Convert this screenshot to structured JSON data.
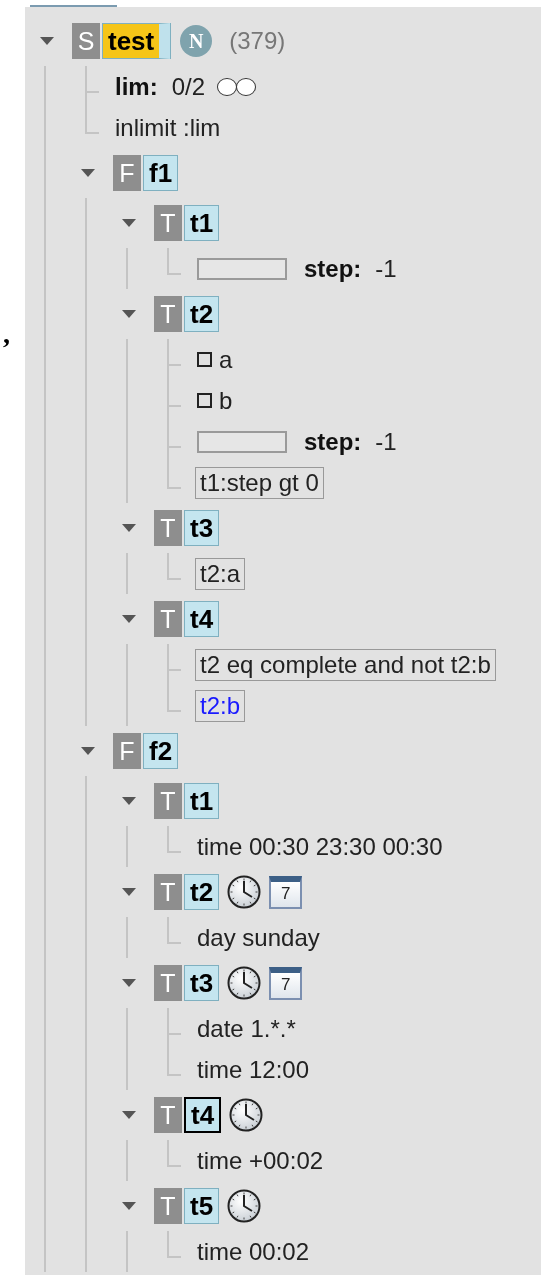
{
  "stray_mark": ",",
  "tree": [
    {
      "kind": "node",
      "type": "S",
      "name": "test",
      "color": "#f5c518",
      "tail": true,
      "focused": false,
      "expanded": true,
      "flag": "N",
      "count": "(379)",
      "children": [
        {
          "kind": "limit",
          "label": "lim:",
          "value": "0/2",
          "slots": [
            {
              "used": false
            },
            {
              "used": false
            }
          ]
        },
        {
          "kind": "text",
          "text": "inlimit :lim"
        },
        {
          "kind": "node",
          "type": "F",
          "name": "f1",
          "color": "#c4e5ef",
          "focused": false,
          "expanded": true,
          "children": [
            {
              "kind": "node",
              "type": "T",
              "name": "t1",
              "color": "#c4e5ef",
              "focused": false,
              "expanded": true,
              "children": [
                {
                  "kind": "meter",
                  "label": "step:",
                  "value": "-1"
                }
              ]
            },
            {
              "kind": "node",
              "type": "T",
              "name": "t2",
              "color": "#c4e5ef",
              "focused": false,
              "expanded": true,
              "children": [
                {
                  "kind": "checkbox",
                  "label": "a",
                  "checked": false
                },
                {
                  "kind": "checkbox",
                  "label": "b",
                  "checked": false
                },
                {
                  "kind": "meter",
                  "label": "step:",
                  "value": "-1"
                },
                {
                  "kind": "expression",
                  "text": "t1:step gt 0",
                  "satisfied": false
                }
              ]
            },
            {
              "kind": "node",
              "type": "T",
              "name": "t3",
              "color": "#c4e5ef",
              "focused": false,
              "expanded": true,
              "children": [
                {
                  "kind": "expression",
                  "text": "t2:a",
                  "satisfied": false
                }
              ]
            },
            {
              "kind": "node",
              "type": "T",
              "name": "t4",
              "color": "#c4e5ef",
              "focused": false,
              "expanded": true,
              "children": [
                {
                  "kind": "expression",
                  "text": "t2 eq complete and not t2:b",
                  "satisfied": false
                },
                {
                  "kind": "expression",
                  "text": "t2:b",
                  "satisfied": true
                }
              ]
            }
          ]
        },
        {
          "kind": "node",
          "type": "F",
          "name": "f2",
          "color": "#c4e5ef",
          "focused": false,
          "expanded": true,
          "children": [
            {
              "kind": "node",
              "type": "T",
              "name": "t1",
              "color": "#c4e5ef",
              "focused": false,
              "expanded": true,
              "children": [
                {
                  "kind": "text",
                  "text": "time 00:30 23:30 00:30"
                }
              ]
            },
            {
              "kind": "node",
              "type": "T",
              "name": "t2",
              "color": "#c4e5ef",
              "focused": false,
              "expanded": true,
              "icons": [
                {
                  "kind": "clock"
                },
                {
                  "kind": "calendar",
                  "label": "7"
                }
              ],
              "children": [
                {
                  "kind": "text",
                  "text": "day sunday"
                }
              ]
            },
            {
              "kind": "node",
              "type": "T",
              "name": "t3",
              "color": "#c4e5ef",
              "focused": false,
              "expanded": true,
              "icons": [
                {
                  "kind": "clock"
                },
                {
                  "kind": "calendar",
                  "label": "7"
                }
              ],
              "children": [
                {
                  "kind": "text",
                  "text": "date 1.*.*"
                },
                {
                  "kind": "text",
                  "text": "time 12:00"
                }
              ]
            },
            {
              "kind": "node",
              "type": "T",
              "name": "t4",
              "color": "#c4e5ef",
              "focused": true,
              "expanded": true,
              "icons": [
                {
                  "kind": "clock"
                }
              ],
              "children": [
                {
                  "kind": "text",
                  "text": "time +00:02"
                }
              ]
            },
            {
              "kind": "node",
              "type": "T",
              "name": "t5",
              "color": "#c4e5ef",
              "focused": false,
              "expanded": true,
              "icons": [
                {
                  "kind": "clock"
                }
              ],
              "children": [
                {
                  "kind": "text",
                  "text": "time 00:02"
                }
              ]
            }
          ]
        }
      ]
    }
  ]
}
